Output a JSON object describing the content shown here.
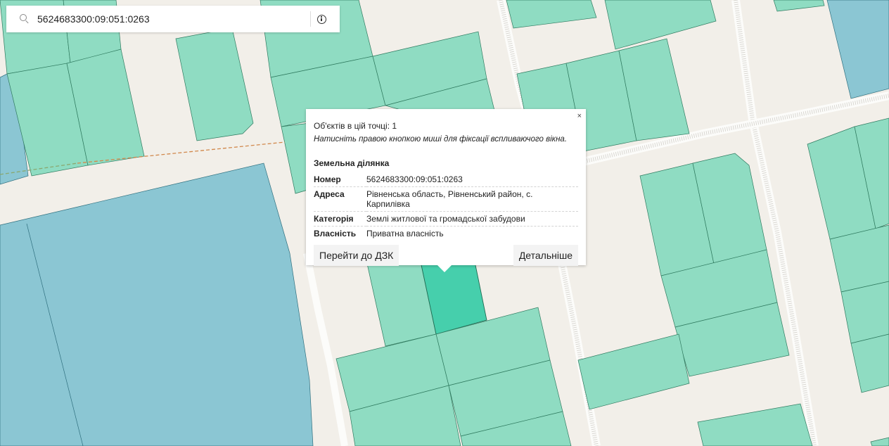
{
  "search": {
    "value": "5624683300:09:051:0263",
    "icon": "search-icon",
    "info_icon": "info-icon"
  },
  "popup": {
    "close_label": "×",
    "objects_count": "Об'єктів в цій точці: 1",
    "hint": "Натисніть правою кнопкою миші для фіксації вспливаючого вікна.",
    "heading": "Земельна ділянка",
    "attributes": [
      {
        "key": "Номер",
        "value": "5624683300:09:051:0263"
      },
      {
        "key": "Адреса",
        "value": "Рівненська область, Рівненський район, с. Карпилівка"
      },
      {
        "key": "Категорія",
        "value": "Землі житлової та громадської забудови"
      },
      {
        "key": "Власність",
        "value": "Приватна власність"
      }
    ],
    "button_dzk": "Перейти до ДЗК",
    "button_details": "Детальніше"
  },
  "map_colors": {
    "background": "#f2efe9",
    "parcel": "#8fdcc2",
    "parcel_selected": "#46cfac",
    "water": "#8bc6d3",
    "road": "#fcfcfa",
    "boundary_line": "#d1884c"
  }
}
